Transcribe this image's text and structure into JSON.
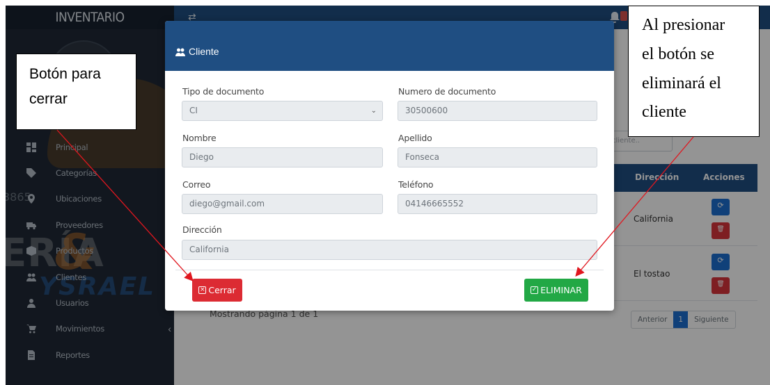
{
  "app": {
    "title": "INVENTARIO"
  },
  "sidebar": {
    "items": [
      {
        "label": "Principal",
        "icon": "dashboard-icon"
      },
      {
        "label": "Categorías",
        "icon": "tag-icon"
      },
      {
        "label": "Ubicaciones",
        "icon": "location-icon"
      },
      {
        "label": "Proveedores",
        "icon": "truck-icon"
      },
      {
        "label": "Productos",
        "icon": "box-icon"
      },
      {
        "label": "Clientes",
        "icon": "users-icon"
      },
      {
        "label": "Usuarios",
        "icon": "user-icon"
      },
      {
        "label": "Movimientos",
        "icon": "cart-icon"
      },
      {
        "label": "Reportes",
        "icon": "report-icon"
      }
    ],
    "collapse_glyph": "‹"
  },
  "topbar": {
    "toggle_glyph": "⇄"
  },
  "background": {
    "search_placeholder": "cliente..",
    "table_headers": {
      "address": "Dirección",
      "actions": "Acciones"
    },
    "rows": [
      {
        "address": "California"
      },
      {
        "address": "El tostao"
      }
    ],
    "footer_text": "Mostrando página 1 de 1",
    "pager": {
      "prev": "Anterior",
      "page": "1",
      "next": "Siguiente"
    }
  },
  "modal": {
    "title": "Cliente",
    "fields": {
      "doc_type": {
        "label": "Tipo de documento",
        "value": "CI"
      },
      "doc_number": {
        "label": "Numero de documento",
        "value": "30500600"
      },
      "first_name": {
        "label": "Nombre",
        "value": "Diego"
      },
      "last_name": {
        "label": "Apellido",
        "value": "Fonseca"
      },
      "email": {
        "label": "Correo",
        "value": "diego@gmail.com"
      },
      "phone": {
        "label": "Teléfono",
        "value": "04146665552"
      },
      "address": {
        "label": "Dirección",
        "value": "California"
      }
    },
    "close_label": "Cerrar",
    "delete_label": "ELIMINAR"
  },
  "callouts": {
    "left": [
      "Botón para",
      "cerrar"
    ],
    "right": [
      "Al presionar",
      "el botón se",
      "eliminará el",
      "cliente"
    ]
  },
  "colors": {
    "sidebar_bg": "#1f2936",
    "header_blue": "#1f4e82",
    "danger": "#dc2b33",
    "success": "#22a845",
    "primary": "#1c6fd1",
    "annotation_arrow": "#e0171f"
  }
}
